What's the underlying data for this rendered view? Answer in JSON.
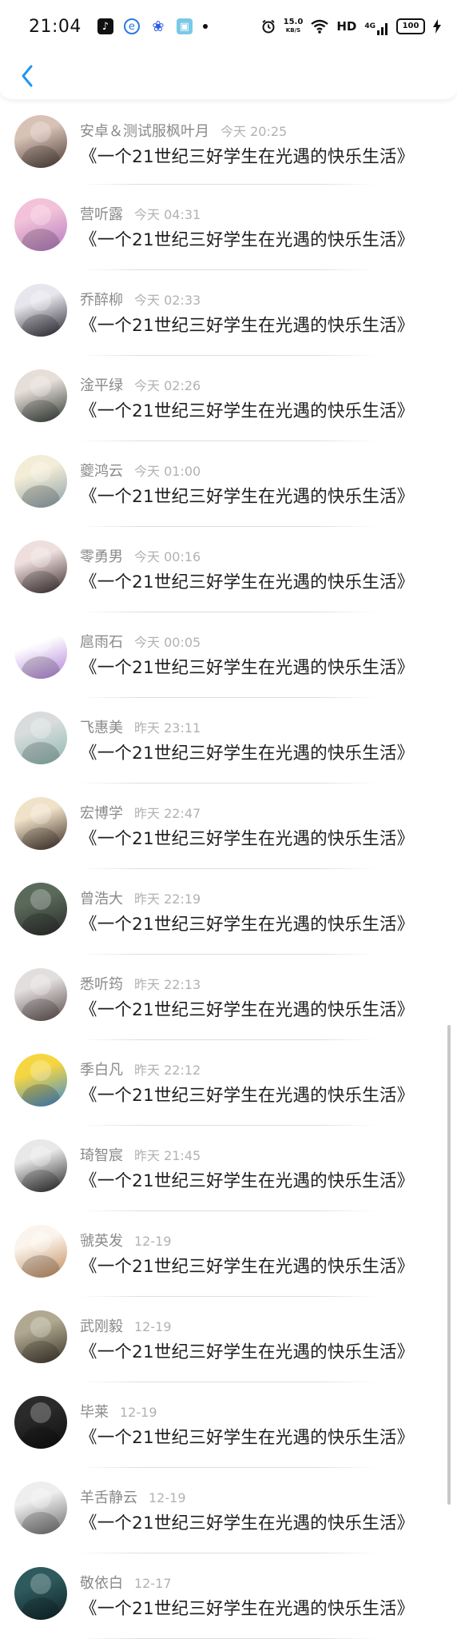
{
  "status_bar": {
    "time": "21:04",
    "net_speed_value": "15.0",
    "net_speed_unit": "KB/S",
    "hd_label": "HD",
    "signal_label": "4G",
    "battery_level": "100"
  },
  "nav": {
    "back_icon": "chevron-left-icon"
  },
  "colors": {
    "accent": "#2196f3",
    "name_text": "#8a8a8a",
    "time_text": "#b2b2b2",
    "content_text": "#1e1e1e"
  },
  "comments": [
    {
      "name": "安卓＆测试服枫叶月",
      "time": "今天 20:25",
      "text": "《一个21世纪三好学生在光遇的快乐生活》",
      "avatar_colors": [
        "#d8c2b6",
        "#4a3a34"
      ]
    },
    {
      "name": "营听露",
      "time": "今天 04:31",
      "text": "《一个21世纪三好学生在光遇的快乐生活》",
      "avatar_colors": [
        "#f2c2d8",
        "#b57ac2"
      ]
    },
    {
      "name": "乔醉柳",
      "time": "今天 02:33",
      "text": "《一个21世纪三好学生在光遇的快乐生活》",
      "avatar_colors": [
        "#e6e6ec",
        "#2a2630"
      ]
    },
    {
      "name": "淦平绿",
      "time": "今天 02:26",
      "text": "《一个21世纪三好学生在光遇的快乐生活》",
      "avatar_colors": [
        "#e6ded8",
        "#2f3a32"
      ]
    },
    {
      "name": "夔鸿云",
      "time": "今天 01:00",
      "text": "《一个21世纪三好学生在光遇的快乐生活》",
      "avatar_colors": [
        "#f3ecd6",
        "#8aa0a8"
      ]
    },
    {
      "name": "零勇男",
      "time": "今天 00:16",
      "text": "《一个21世纪三好学生在光遇的快乐生活》",
      "avatar_colors": [
        "#eedede",
        "#3a2a2a"
      ]
    },
    {
      "name": "扈雨石",
      "time": "今天 00:05",
      "text": "《一个21世纪三好学生在光遇的快乐生活》",
      "avatar_colors": [
        "#ffffff",
        "#b080d8"
      ]
    },
    {
      "name": "飞惠美",
      "time": "昨天 23:11",
      "text": "《一个21世纪三好学生在光遇的快乐生活》",
      "avatar_colors": [
        "#d8dcdc",
        "#8cb8b0"
      ]
    },
    {
      "name": "宏博学",
      "time": "昨天 22:47",
      "text": "《一个21世纪三好学生在光遇的快乐生活》",
      "avatar_colors": [
        "#f0e2c8",
        "#3a2a22"
      ]
    },
    {
      "name": "曾浩大",
      "time": "昨天 22:19",
      "text": "《一个21世纪三好学生在光遇的快乐生活》",
      "avatar_colors": [
        "#5a6a5a",
        "#2a2a2a"
      ]
    },
    {
      "name": "悉听筠",
      "time": "昨天 22:13",
      "text": "《一个21世纪三好学生在光遇的快乐生活》",
      "avatar_colors": [
        "#e2dede",
        "#5a4a4a"
      ]
    },
    {
      "name": "季白凡",
      "time": "昨天 22:12",
      "text": "《一个21世纪三好学生在光遇的快乐生活》",
      "avatar_colors": [
        "#f6d640",
        "#3a8ad8"
      ]
    },
    {
      "name": "琦智宸",
      "time": "昨天 21:45",
      "text": "《一个21世纪三好学生在光遇的快乐生活》",
      "avatar_colors": [
        "#e8e8e8",
        "#222222"
      ]
    },
    {
      "name": "虢英发",
      "time": "12-19",
      "text": "《一个21世纪三好学生在光遇的快乐生活》",
      "avatar_colors": [
        "#fbf4ec",
        "#c08a5a"
      ]
    },
    {
      "name": "武刚毅",
      "time": "12-19",
      "text": "《一个21世纪三好学生在光遇的快乐生活》",
      "avatar_colors": [
        "#b0a890",
        "#3a3428"
      ]
    },
    {
      "name": "毕莱",
      "time": "12-19",
      "text": "《一个21世纪三好学生在光遇的快乐生活》",
      "avatar_colors": [
        "#2a2a2a",
        "#0e0e0e"
      ]
    },
    {
      "name": "羊舌静云",
      "time": "12-19",
      "text": "《一个21世纪三好学生在光遇的快乐生活》",
      "avatar_colors": [
        "#eeeeee",
        "#6a6a6a"
      ]
    },
    {
      "name": "敬依白",
      "time": "12-17",
      "text": "《一个21世纪三好学生在光遇的快乐生活》",
      "avatar_colors": [
        "#2e5a5e",
        "#0f2226"
      ]
    }
  ]
}
